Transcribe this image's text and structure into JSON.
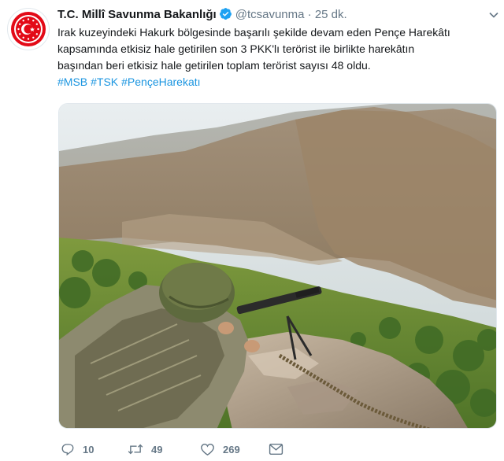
{
  "tweet": {
    "display_name": "T.C. Millî Savunma Bakanlığı",
    "handle": "@tcsavunma",
    "separator": "·",
    "time": "25 dk.",
    "verified": true,
    "text_lines": [
      "Irak kuzeyindeki Hakurk bölgesinde başarılı şekilde devam eden Pençe Harekâtı",
      "kapsamında etkisiz hale getirilen son 3 PKK'lı terörist ile birlikte harekâtın",
      "başından beri etkisiz hale getirilen toplam terörist sayısı 48 oldu."
    ],
    "hashtags": [
      "#MSB",
      "#TSK",
      "#PençeHarekatı"
    ]
  },
  "actions": {
    "replies": "10",
    "retweets": "49",
    "likes": "269"
  },
  "colors": {
    "link": "#1b95e0",
    "muted": "#657786",
    "brand_red": "#e30a17",
    "verified": "#1da1f2"
  },
  "icons": [
    "emblem-avatar",
    "verified-badge-icon",
    "chevron-down-icon",
    "reply-icon",
    "retweet-icon",
    "like-icon",
    "direct-message-icon"
  ]
}
